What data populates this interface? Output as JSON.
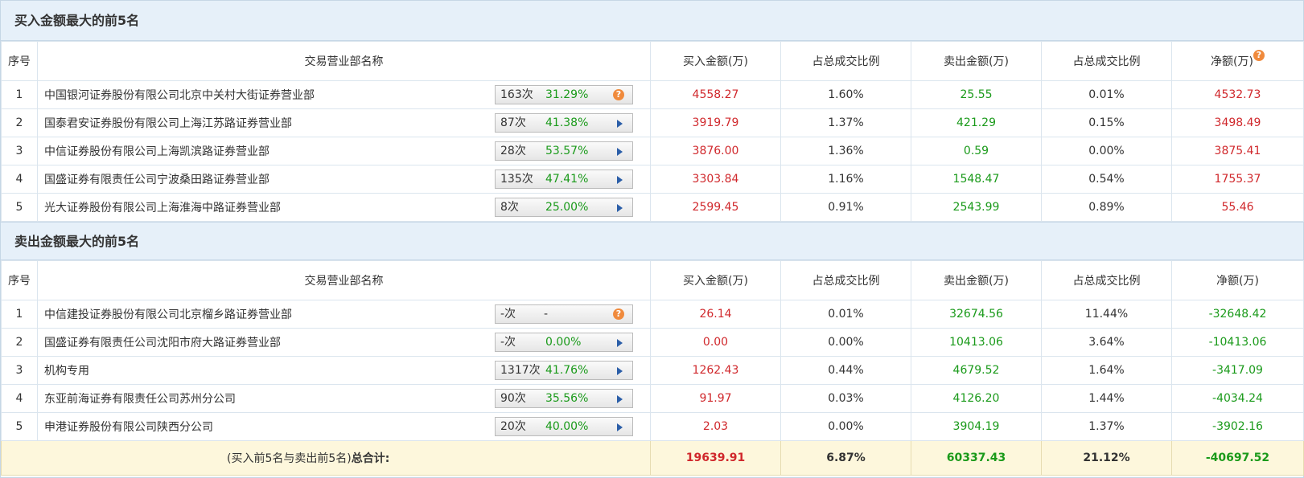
{
  "buy_section": {
    "title": "买入金额最大的前5名",
    "headers": [
      "序号",
      "交易营业部名称",
      "买入金额(万)",
      "占总成交比例",
      "卖出金额(万)",
      "占总成交比例",
      "净额(万)"
    ],
    "rows": [
      {
        "idx": "1",
        "name": "中国银河证券股份有限公司北京中关村大街证券营业部",
        "count": "163次",
        "pct": "31.29%",
        "icon": "question-icon",
        "buy": "4558.27",
        "buy_ratio": "1.60%",
        "sell": "25.55",
        "sell_ratio": "0.01%",
        "net": "4532.73"
      },
      {
        "idx": "2",
        "name": "国泰君安证券股份有限公司上海江苏路证券营业部",
        "count": "87次",
        "pct": "41.38%",
        "icon": "play-icon",
        "buy": "3919.79",
        "buy_ratio": "1.37%",
        "sell": "421.29",
        "sell_ratio": "0.15%",
        "net": "3498.49"
      },
      {
        "idx": "3",
        "name": "中信证券股份有限公司上海凯滨路证券营业部",
        "count": "28次",
        "pct": "53.57%",
        "icon": "play-icon",
        "buy": "3876.00",
        "buy_ratio": "1.36%",
        "sell": "0.59",
        "sell_ratio": "0.00%",
        "net": "3875.41"
      },
      {
        "idx": "4",
        "name": "国盛证券有限责任公司宁波桑田路证券营业部",
        "count": "135次",
        "pct": "47.41%",
        "icon": "play-icon",
        "buy": "3303.84",
        "buy_ratio": "1.16%",
        "sell": "1548.47",
        "sell_ratio": "0.54%",
        "net": "1755.37"
      },
      {
        "idx": "5",
        "name": "光大证券股份有限公司上海淮海中路证券营业部",
        "count": "8次",
        "pct": "25.00%",
        "icon": "play-icon",
        "buy": "2599.45",
        "buy_ratio": "0.91%",
        "sell": "2543.99",
        "sell_ratio": "0.89%",
        "net": "55.46"
      }
    ]
  },
  "sell_section": {
    "title": "卖出金额最大的前5名",
    "headers": [
      "序号",
      "交易营业部名称",
      "买入金额(万)",
      "占总成交比例",
      "卖出金额(万)",
      "占总成交比例",
      "净额(万)"
    ],
    "rows": [
      {
        "idx": "1",
        "name": "中信建投证券股份有限公司北京榴乡路证券营业部",
        "count": "-次",
        "pct": "-",
        "icon": "question-icon",
        "buy": "26.14",
        "buy_ratio": "0.01%",
        "sell": "32674.56",
        "sell_ratio": "11.44%",
        "net": "-32648.42"
      },
      {
        "idx": "2",
        "name": "国盛证券有限责任公司沈阳市府大路证券营业部",
        "count": "-次",
        "pct": "0.00%",
        "icon": "play-icon",
        "buy": "0.00",
        "buy_ratio": "0.00%",
        "sell": "10413.06",
        "sell_ratio": "3.64%",
        "net": "-10413.06"
      },
      {
        "idx": "3",
        "name": "机构专用",
        "count": "1317次",
        "pct": "41.76%",
        "icon": "play-icon",
        "buy": "1262.43",
        "buy_ratio": "0.44%",
        "sell": "4679.52",
        "sell_ratio": "1.64%",
        "net": "-3417.09"
      },
      {
        "idx": "4",
        "name": "东亚前海证券有限责任公司苏州分公司",
        "count": "90次",
        "pct": "35.56%",
        "icon": "play-icon",
        "buy": "91.97",
        "buy_ratio": "0.03%",
        "sell": "4126.20",
        "sell_ratio": "1.44%",
        "net": "-4034.24"
      },
      {
        "idx": "5",
        "name": "申港证券股份有限公司陕西分公司",
        "count": "20次",
        "pct": "40.00%",
        "icon": "play-icon",
        "buy": "2.03",
        "buy_ratio": "0.00%",
        "sell": "3904.19",
        "sell_ratio": "1.37%",
        "net": "-3902.16"
      }
    ]
  },
  "totals": {
    "label_prefix": "(买入前5名与卖出前5名)",
    "label_bold": "总合计:",
    "buy": "19639.91",
    "buy_ratio": "6.87%",
    "sell": "60337.43",
    "sell_ratio": "21.12%",
    "net": "-40697.52"
  },
  "net_header_icon": "question-icon",
  "colors": {
    "red": "#d0282c",
    "green": "#1a9a1a",
    "header_bg": "#e6f0f9",
    "total_bg": "#fdf7dc",
    "accent_icon": "#f08a3c"
  }
}
